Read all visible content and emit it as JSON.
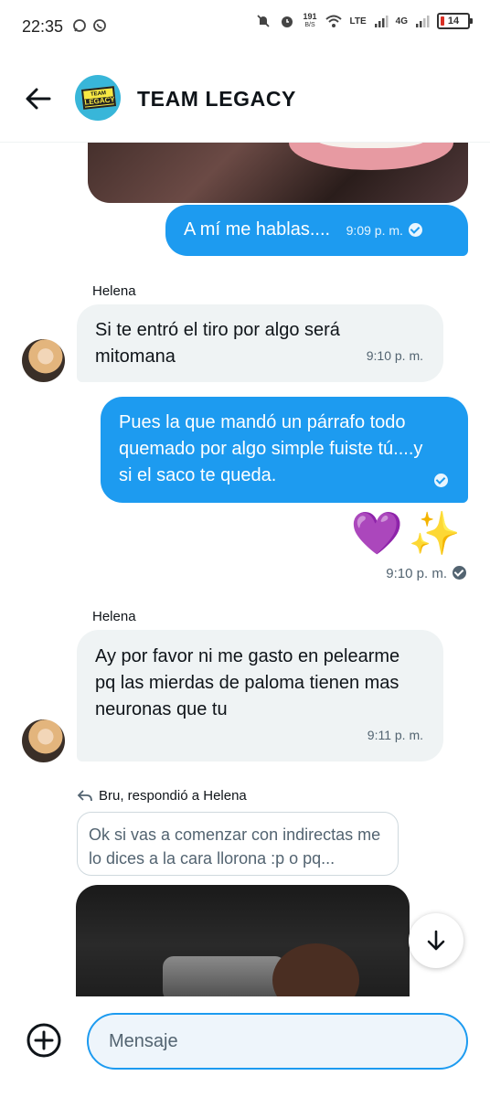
{
  "status_bar": {
    "time": "22:35",
    "net_speed_value": "191",
    "net_speed_unit": "B/S",
    "lte_label": "LTE",
    "g4_label": "4G",
    "battery": "14",
    "icons": [
      "message-bubble-icon",
      "whatsapp-icon",
      "mute-icon",
      "alarm-icon",
      "wifi-icon",
      "signal-icon",
      "battery-icon"
    ]
  },
  "header": {
    "title": "TEAM LEGACY",
    "avatar_small_text": "TEAM",
    "avatar_big_text": "LEGACY"
  },
  "messages": [
    {
      "type": "image",
      "direction": "incoming",
      "icon": "image-attachment"
    },
    {
      "type": "text",
      "direction": "outgoing",
      "text": "A mí me hablas....",
      "time": "9:09 p. m.",
      "status": "read"
    },
    {
      "type": "text",
      "direction": "incoming",
      "sender": "Helena",
      "text": "Si te entró el tiro por algo será mitomana",
      "time": "9:10 p. m."
    },
    {
      "type": "text",
      "direction": "outgoing",
      "text": "Pues la que mandó un párrafo todo quemado por algo simple fuiste tú....y si el saco te queda.",
      "time": "",
      "status": "read"
    },
    {
      "type": "emoji",
      "direction": "outgoing",
      "emoji_heart": "💜",
      "emoji_sparkles": "✨",
      "time": "9:10 p. m.",
      "status": "read"
    },
    {
      "type": "text",
      "direction": "incoming",
      "sender": "Helena",
      "text": "Ay por favor ni me gasto en pelearme pq las mierdas de paloma tienen mas neuronas que tu",
      "time": "9:11 p. m."
    },
    {
      "type": "reply",
      "direction": "incoming",
      "reply_context": "Bru, respondió a Helena",
      "quoted_text": "Ok si vas a comenzar con indirectas me lo dices a la cara llorona :p o pq..."
    }
  ],
  "composer": {
    "placeholder": "Mensaje"
  },
  "colors": {
    "outgoing_bubble": "#1d9bf0",
    "incoming_bubble": "#eff3f4",
    "accent": "#1d9bf0"
  }
}
